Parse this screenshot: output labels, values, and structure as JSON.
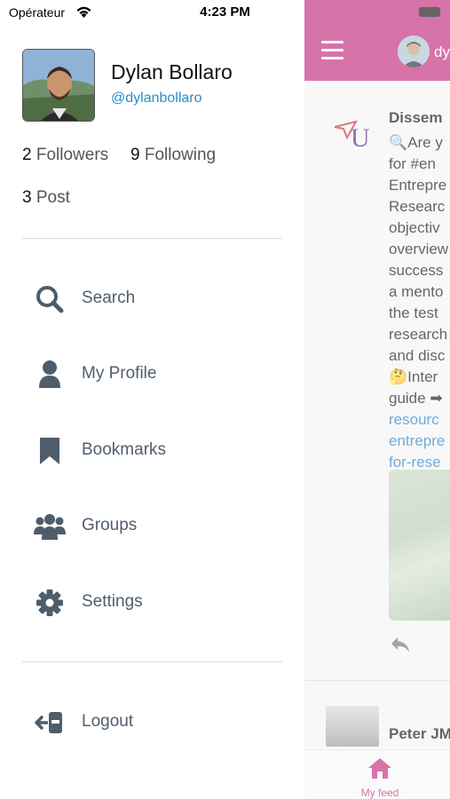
{
  "status_bar": {
    "carrier": "Opérateur",
    "time": "4:23 PM"
  },
  "profile": {
    "name": "Dylan Bollaro",
    "handle": "@dylanbollaro",
    "followers_count": "2",
    "followers_label": "Followers",
    "following_count": "9",
    "following_label": "Following",
    "posts_count": "3",
    "posts_label": "Post"
  },
  "menu": {
    "search": "Search",
    "my_profile": "My Profile",
    "bookmarks": "Bookmarks",
    "groups": "Groups",
    "settings": "Settings",
    "logout": "Logout"
  },
  "background_app": {
    "header_username": "dy",
    "post_author": "Dissem",
    "post_lines": [
      "Are y",
      "for #en",
      "Entrepre",
      "Researc",
      "objectiv",
      "overview",
      "success",
      "a mento",
      "the test",
      "research",
      "and disc",
      "Inter",
      "guide"
    ],
    "post_link_lines": [
      "resourc",
      "entrepre",
      "for-rese"
    ],
    "second_post_author": "Peter JM",
    "tab_label": "My feed"
  },
  "colors": {
    "brand": "#c0297c",
    "link": "#2b8bd0",
    "menu_text": "#505e6c",
    "icon": "#4f5d6b"
  },
  "icons": [
    "wifi-icon",
    "search-icon",
    "user-icon",
    "bookmark-icon",
    "groups-icon",
    "gear-icon",
    "logout-icon",
    "hamburger-icon",
    "reply-icon",
    "home-icon"
  ]
}
